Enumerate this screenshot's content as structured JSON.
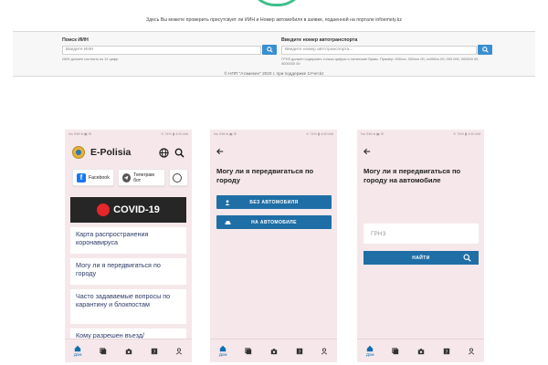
{
  "web": {
    "description": "Здесь Вы можете проверить присутсвует ли ИИН и Номер автомобиля в заявке, подаенной на портале infoemety.kz",
    "iin_search": {
      "label": "Поиск ИИН",
      "placeholder": "Введите ИИН",
      "hint": "ИИН должен состоять из 12 цифр"
    },
    "vehicle_search": {
      "label": "Введите номер автотранспорта",
      "placeholder": "Введите номер автотранспорта...",
      "hint": "ГРНЗ должен содержать только цифры и латинские буквы. Пример: 000ххх, 000ххх 00, хх000хх 00, 000 000, 000000 00, 0000000 00"
    },
    "footer": "© НПП \"Атамекен\" 2020 г. при поддержке 1Учет.kz"
  },
  "status": {
    "left": "No SIM ● ▣ ⚙",
    "right": "✕ 74% ▮ 4:00 AM"
  },
  "phone1": {
    "title": "E-Polisia",
    "social": [
      {
        "label": "Facebook"
      },
      {
        "label": "Телеграм бот"
      }
    ],
    "covid_banner": "COVID-19",
    "cards": [
      "Карта распространения коронавируса",
      "Могу ли я передвигаться по городу",
      "Часто задаваемые вопросы по карантину и блокпостам",
      "Кому разрешен въезд/"
    ]
  },
  "phone2": {
    "question": "Могу ли я передвигаться по городу",
    "btn_no_car": "БЕЗ АВТОМОБИЛЯ",
    "btn_car": "НА АВТОМОБИЛЕ"
  },
  "phone3": {
    "question": "Могу ли я передвигаться по городу на автомобиле",
    "plate_placeholder": "ГРНЗ",
    "find_btn": "НАЙТИ"
  },
  "nav": {
    "home_label": "Дом"
  },
  "colors": {
    "primary": "#1f6fa6",
    "phone_bg": "#f6e8ea",
    "accent": "#3a8fd0"
  }
}
